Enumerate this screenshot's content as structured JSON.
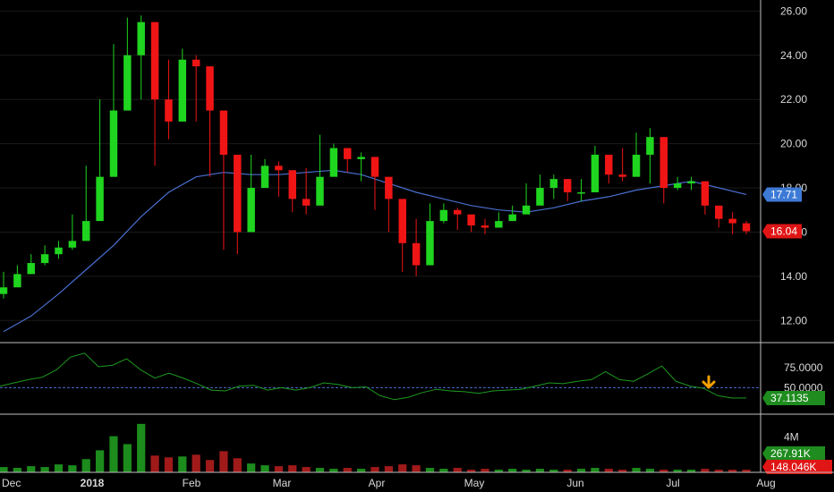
{
  "chart_data": [
    {
      "type": "candlestick",
      "panel": "price",
      "ylim": [
        11,
        26.5
      ],
      "y_ticks": [
        "26.00",
        "24.00",
        "22.00",
        "20.00",
        "18.00",
        "16.00",
        "14.00",
        "12.00"
      ],
      "y_tick_values": [
        26,
        24,
        22,
        20,
        18,
        16,
        14,
        12
      ],
      "moving_average": {
        "color": "#4a6fd0",
        "values": [
          11.5,
          12.2,
          13.2,
          14.3,
          15.4,
          16.7,
          17.8,
          18.5,
          18.7,
          18.6,
          18.6,
          18.7,
          18.8,
          18.6,
          18.2,
          17.8,
          17.5,
          17.2,
          17.0,
          16.9,
          17.1,
          17.4,
          17.6,
          17.9,
          18.1,
          18.3,
          18.0,
          17.7
        ]
      },
      "last_ma_label": "17.71",
      "last_price_label": "16.04",
      "up_color": "#1fd51f",
      "down_color": "#f01515",
      "closes": [
        13.5,
        14.1,
        14.6,
        15.0,
        15.3,
        15.6,
        16.5,
        18.5,
        21.5,
        24.0,
        25.5,
        22.0,
        21.0,
        23.8,
        23.5,
        21.5,
        19.5,
        16.0,
        18.0,
        19.0,
        18.8,
        17.5,
        17.2,
        18.5,
        19.8,
        19.3,
        19.4,
        18.5,
        17.5,
        15.5,
        14.5,
        16.5,
        17.0,
        16.8,
        16.3,
        16.2,
        16.5,
        16.8,
        17.2,
        18.0,
        18.4,
        17.8,
        17.8,
        19.5,
        18.6,
        18.5,
        19.5,
        20.3,
        18.0,
        18.2,
        18.3,
        17.2,
        16.6,
        16.4,
        16.04
      ],
      "highs": [
        14.2,
        14.5,
        15.0,
        15.4,
        15.6,
        16.8,
        19.0,
        22.0,
        24.5,
        25.7,
        25.8,
        23.0,
        23.8,
        24.3,
        24.0,
        21.8,
        20.3,
        18.5,
        19.5,
        19.3,
        19.2,
        18.8,
        18.9,
        20.4,
        20.0,
        19.8,
        19.6,
        18.8,
        18.0,
        16.8,
        16.6,
        17.3,
        17.3,
        17.1,
        16.7,
        16.6,
        16.9,
        17.2,
        18.2,
        18.6,
        18.6,
        18.4,
        18.4,
        19.9,
        19.0,
        19.8,
        20.5,
        20.7,
        18.7,
        18.5,
        18.5,
        18.2,
        17.1,
        16.9,
        16.5
      ],
      "lows": [
        13.0,
        13.6,
        14.1,
        14.5,
        14.8,
        15.2,
        16.2,
        18.0,
        20.5,
        22.5,
        22.0,
        19.0,
        20.2,
        22.5,
        21.0,
        18.5,
        15.2,
        15.0,
        16.5,
        18.0,
        17.6,
        16.9,
        16.8,
        18.0,
        18.6,
        18.7,
        18.3,
        17.0,
        16.0,
        14.2,
        14.0,
        15.8,
        16.4,
        16.1,
        16.0,
        15.9,
        16.2,
        16.5,
        16.9,
        17.6,
        17.5,
        17.4,
        17.4,
        18.2,
        18.2,
        18.3,
        19.3,
        18.2,
        17.3,
        17.9,
        17.9,
        16.8,
        16.2,
        15.9,
        15.9
      ]
    },
    {
      "type": "line",
      "panel": "oscillator",
      "ylim": [
        17,
        105
      ],
      "y_ticks": [
        "75.0000",
        "50.0000"
      ],
      "y_tick_values": [
        75,
        50
      ],
      "reference_line": 50,
      "color": "#1e9a1e",
      "values": [
        52,
        56,
        60,
        63,
        72,
        88,
        93,
        76,
        78,
        86,
        72,
        62,
        68,
        62,
        55,
        47,
        46,
        52,
        53,
        47,
        50,
        47,
        50,
        56,
        54,
        50,
        51,
        40,
        35,
        38,
        44,
        48,
        46,
        45,
        43,
        46,
        47,
        48,
        52,
        56,
        55,
        58,
        60,
        70,
        60,
        58,
        67,
        77,
        58,
        52,
        49,
        40,
        37,
        37.1135
      ],
      "last_value_label": "37.1135",
      "annotation": "down-arrow"
    },
    {
      "type": "bar",
      "panel": "volume",
      "ylim": [
        0,
        6.5
      ],
      "y_ticks": [
        "4M"
      ],
      "y_tick_values": [
        4
      ],
      "up_color": "#1c8c1c",
      "down_color": "#a01a1a",
      "values": [
        0.6,
        0.5,
        0.7,
        0.6,
        0.9,
        0.8,
        1.5,
        2.5,
        4.1,
        3.2,
        5.5,
        1.9,
        1.7,
        1.8,
        2.0,
        1.4,
        2.4,
        1.6,
        1.0,
        0.8,
        0.7,
        0.8,
        0.6,
        0.5,
        0.4,
        0.5,
        0.4,
        0.6,
        0.7,
        0.9,
        0.8,
        0.5,
        0.4,
        0.5,
        0.3,
        0.4,
        0.3,
        0.4,
        0.3,
        0.4,
        0.3,
        0.3,
        0.4,
        0.5,
        0.4,
        0.3,
        0.5,
        0.4,
        0.3,
        0.3,
        0.3,
        0.4,
        0.3,
        0.3,
        0.3
      ],
      "up": [
        true,
        true,
        true,
        true,
        true,
        true,
        true,
        true,
        true,
        true,
        true,
        false,
        false,
        true,
        false,
        false,
        false,
        false,
        true,
        true,
        false,
        false,
        false,
        true,
        true,
        false,
        true,
        false,
        false,
        false,
        false,
        true,
        true,
        false,
        false,
        false,
        true,
        true,
        true,
        true,
        true,
        false,
        true,
        true,
        false,
        false,
        true,
        true,
        false,
        true,
        true,
        false,
        false,
        false,
        false
      ],
      "last_up_label": "267.91K",
      "last_down_label": "148.046K"
    }
  ],
  "x_axis": {
    "labels": [
      "Dec",
      "2018",
      "Feb",
      "Mar",
      "Apr",
      "May",
      "Jun",
      "Jul",
      "Aug"
    ],
    "bold_label": "2018"
  },
  "colors": {
    "background": "#000000",
    "grid": "#1a1a1a",
    "separator": "#bfbfbf",
    "ma_badge": "#3d7ad6",
    "price_badge": "#e01515",
    "osc_badge": "#1e8c1e",
    "vol_up_badge": "#1e8c1e",
    "vol_down_badge": "#e01515",
    "arrow": "#f5a000",
    "dashed": "#4a6fd0"
  }
}
